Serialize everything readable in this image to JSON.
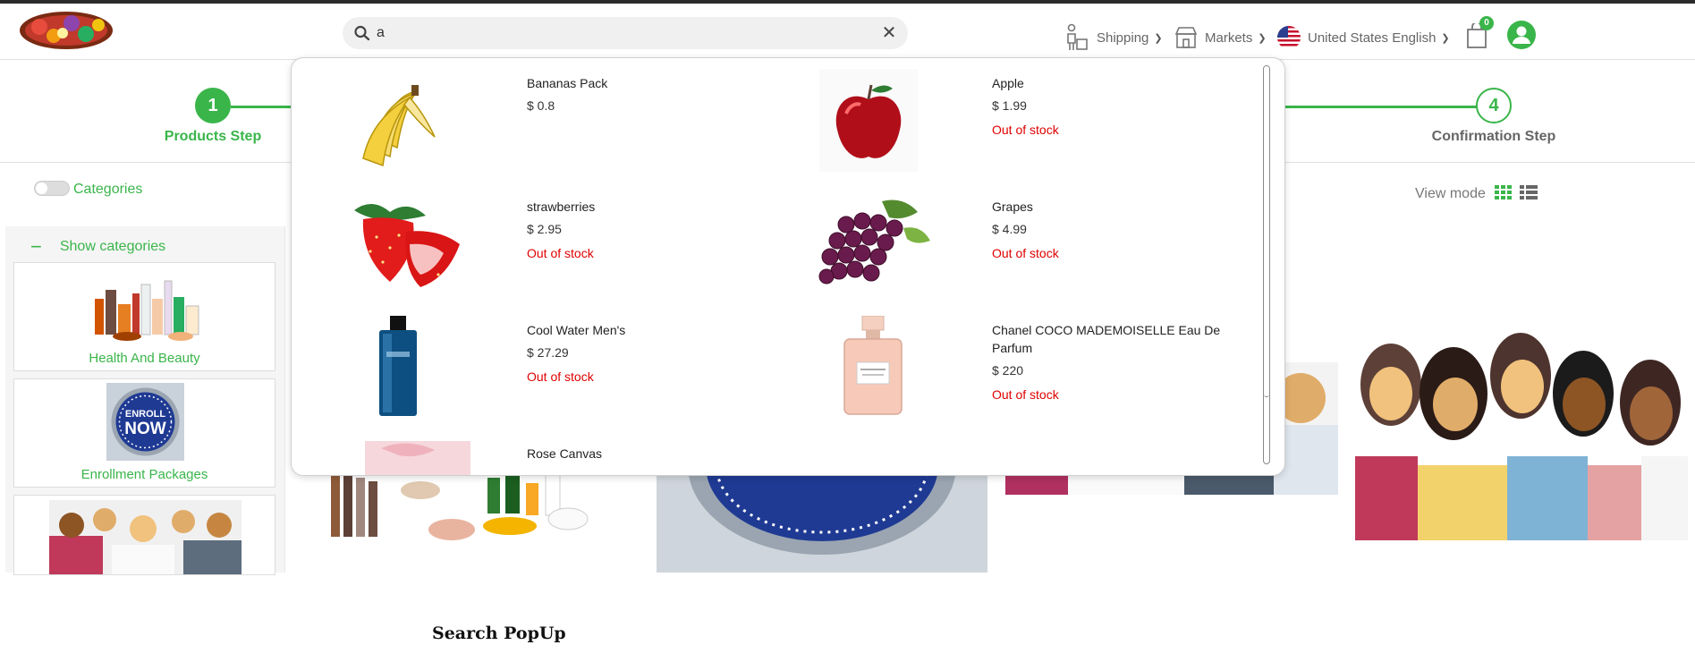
{
  "header": {
    "search_value": "a",
    "search_placeholder": "Search",
    "nav": {
      "shipping": "Shipping",
      "markets": "Markets",
      "language": "United States English"
    },
    "cart_count": "0"
  },
  "steps": [
    {
      "number": "1",
      "label": "Products Step"
    },
    {
      "number": "4",
      "label": "Confirmation Step"
    }
  ],
  "sidebar": {
    "toggle_label": "Categories",
    "show_categories": "Show categories",
    "categories": [
      {
        "name": "Health And Beauty"
      },
      {
        "name": "Enrollment Packages"
      },
      {
        "name": ""
      }
    ]
  },
  "view_mode": "View mode",
  "popup": {
    "items": [
      {
        "name": "Bananas Pack",
        "price": "$ 0.8",
        "stock": ""
      },
      {
        "name": "Apple",
        "price": "$ 1.99",
        "stock": "Out of stock"
      },
      {
        "name": "strawberries",
        "price": "$ 2.95",
        "stock": "Out of stock"
      },
      {
        "name": "Grapes",
        "price": "$ 4.99",
        "stock": "Out of stock"
      },
      {
        "name": "Cool Water Men's",
        "price": "$ 27.29",
        "stock": "Out of stock"
      },
      {
        "name": "Chanel COCO MADEMOISELLE Eau De Parfum",
        "price": "$ 220",
        "stock": "Out of stock"
      },
      {
        "name": "Rose Canvas",
        "price": "",
        "stock": ""
      }
    ]
  },
  "enroll_badge": {
    "line1": "ENROLL",
    "line2": "NOW"
  },
  "caption": "Search  PopUp",
  "colors": {
    "accent": "#3ab54a",
    "out_of_stock": "#e00000"
  }
}
